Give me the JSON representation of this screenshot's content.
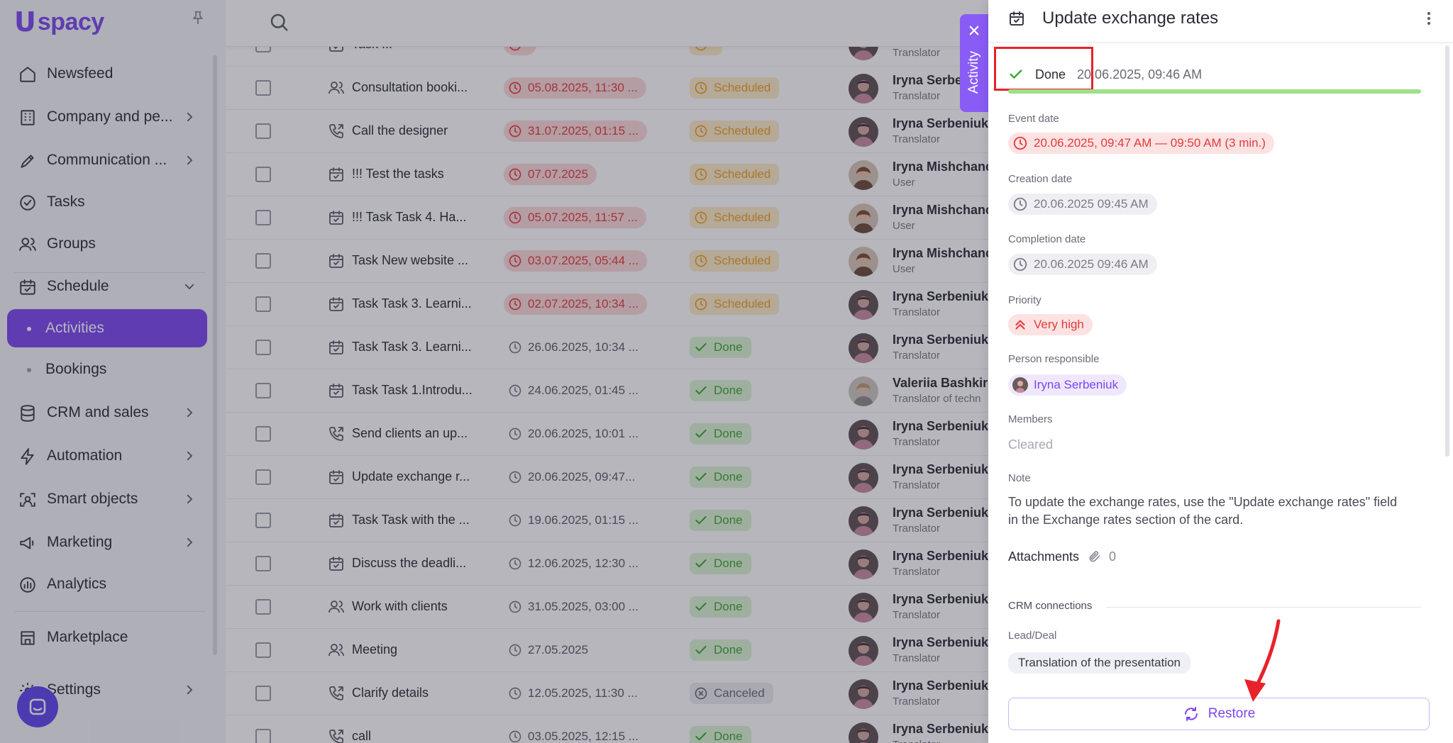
{
  "sidebar": {
    "logo_u": "U",
    "logo_text": "spacy",
    "items": [
      {
        "label": "Newsfeed",
        "icon": "home-icon"
      },
      {
        "label": "Company and pe...",
        "icon": "company-icon"
      },
      {
        "label": "Communication ...",
        "icon": "communication-icon"
      },
      {
        "label": "Tasks",
        "icon": "check-circle-icon"
      },
      {
        "label": "Groups",
        "icon": "groups-icon"
      },
      {
        "label": "Schedule",
        "icon": "calendar-icon"
      },
      {
        "label": "Activities"
      },
      {
        "label": "Bookings"
      },
      {
        "label": "CRM and sales",
        "icon": "database-icon"
      },
      {
        "label": "Automation",
        "icon": "lightning-icon"
      },
      {
        "label": "Smart objects",
        "icon": "smart-objects-icon"
      },
      {
        "label": "Marketing",
        "icon": "marketing-icon"
      },
      {
        "label": "Analytics",
        "icon": "analytics-icon"
      },
      {
        "label": "Marketplace",
        "icon": "store-icon"
      },
      {
        "label": "Settings",
        "icon": "gear-icon"
      }
    ]
  },
  "table": {
    "rows": [
      {
        "name": "Task ...",
        "type": "task",
        "date": "",
        "date_style": "over",
        "status": "",
        "status_style": "scheduled",
        "user": "",
        "role": "Translator",
        "avatar": "iryna-s"
      },
      {
        "name": "Consultation booki...",
        "type": "people",
        "date": "05.08.2025, 11:30 ...",
        "date_style": "over",
        "status": "Scheduled",
        "status_style": "scheduled",
        "user": "Iryna Serbeniuk",
        "role": "Translator",
        "avatar": "iryna-s"
      },
      {
        "name": "Call the designer",
        "type": "call",
        "date": "31.07.2025, 01:15 ...",
        "date_style": "over",
        "status": "Scheduled",
        "status_style": "scheduled",
        "user": "Iryna Serbeniuk",
        "role": "Translator",
        "avatar": "iryna-s"
      },
      {
        "name": "!!! Test the tasks",
        "type": "task",
        "date": "07.07.2025",
        "date_style": "over",
        "status": "Scheduled",
        "status_style": "scheduled",
        "user": "Iryna Mishchanc",
        "role": "User",
        "avatar": "iryna-m"
      },
      {
        "name": "!!! Task Task 4. Ha...",
        "type": "task",
        "date": "05.07.2025, 11:57 ...",
        "date_style": "over",
        "status": "Scheduled",
        "status_style": "scheduled",
        "user": "Iryna Mishchanc",
        "role": "User",
        "avatar": "iryna-m"
      },
      {
        "name": "Task New website ...",
        "type": "task",
        "date": "03.07.2025, 05:44 ...",
        "date_style": "over",
        "status": "Scheduled",
        "status_style": "scheduled",
        "user": "Iryna Mishchanc",
        "role": "User",
        "avatar": "iryna-m"
      },
      {
        "name": "Task Task 3. Learni...",
        "type": "task",
        "date": "02.07.2025, 10:34 ...",
        "date_style": "over",
        "status": "Scheduled",
        "status_style": "scheduled",
        "user": "Iryna Serbeniuk",
        "role": "Translator",
        "avatar": "iryna-s"
      },
      {
        "name": "Task Task 3. Learni...",
        "type": "task",
        "date": "26.06.2025, 10:34 ...",
        "date_style": "norm",
        "status": "Done",
        "status_style": "done",
        "user": "Iryna Serbeniuk",
        "role": "Translator",
        "avatar": "iryna-s"
      },
      {
        "name": "Task Task 1.Introdu...",
        "type": "task",
        "date": "24.06.2025, 01:45 ...",
        "date_style": "norm",
        "status": "Done",
        "status_style": "done",
        "user": "Valeriia Bashkiro",
        "role": "Translator of techn",
        "avatar": "valeriia"
      },
      {
        "name": "Send clients an up...",
        "type": "call",
        "date": "20.06.2025, 10:01 ...",
        "date_style": "norm",
        "status": "Done",
        "status_style": "done",
        "user": "Iryna Serbeniuk",
        "role": "Translator",
        "avatar": "iryna-s"
      },
      {
        "name": "Update exchange r...",
        "type": "task",
        "date": "20.06.2025, 09:47...",
        "date_style": "norm",
        "status": "Done",
        "status_style": "done",
        "user": "Iryna Serbeniuk",
        "role": "Translator",
        "avatar": "iryna-s"
      },
      {
        "name": "Task Task with the ...",
        "type": "task",
        "date": "19.06.2025, 01:15 ...",
        "date_style": "norm",
        "status": "Done",
        "status_style": "done",
        "user": "Iryna Serbeniuk",
        "role": "Translator",
        "avatar": "iryna-s"
      },
      {
        "name": "Discuss the deadli...",
        "type": "task",
        "date": "12.06.2025, 12:30 ...",
        "date_style": "norm",
        "status": "Done",
        "status_style": "done",
        "user": "Iryna Serbeniuk",
        "role": "Translator",
        "avatar": "iryna-s"
      },
      {
        "name": "Work with clients",
        "type": "people",
        "date": "31.05.2025, 03:00 ...",
        "date_style": "norm",
        "status": "Done",
        "status_style": "done",
        "user": "Iryna Serbeniuk",
        "role": "Translator",
        "avatar": "iryna-s"
      },
      {
        "name": "Meeting",
        "type": "people",
        "date": "27.05.2025",
        "date_style": "norm",
        "status": "Done",
        "status_style": "done",
        "user": "Iryna Serbeniuk",
        "role": "Translator",
        "avatar": "iryna-s"
      },
      {
        "name": "Clarify details",
        "type": "call",
        "date": "12.05.2025, 11:30 ...",
        "date_style": "norm",
        "status": "Canceled",
        "status_style": "canceled",
        "user": "Iryna Serbeniuk",
        "role": "Translator",
        "avatar": "iryna-s"
      },
      {
        "name": "call",
        "type": "call",
        "date": "03.05.2025, 12:15 ...",
        "date_style": "norm",
        "status": "Done",
        "status_style": "done",
        "user": "Iryna Serbeniuk",
        "role": "Translator",
        "avatar": "iryna-s"
      }
    ]
  },
  "activity_tab": {
    "label": "Activity"
  },
  "drawer": {
    "title": "Update exchange rates",
    "status": "Done",
    "status_date": "20.06.2025, 09:46 AM",
    "progress": 1.0,
    "event_date_label": "Event date",
    "event_date": "20.06.2025, 09:47 AM — 09:50 AM (3 min.)",
    "creation_date_label": "Creation date",
    "creation_date": "20.06.2025 09:45 AM",
    "completion_date_label": "Completion date",
    "completion_date": "20.06.2025 09:46 AM",
    "priority_label": "Priority",
    "priority": "Very high",
    "person_label": "Person responsible",
    "person": "Iryna Serbeniuk",
    "members_label": "Members",
    "members": "Cleared",
    "note_label": "Note",
    "note": "To update the exchange rates, use the \"Update exchange rates\" field in the Exchange rates section of the card.",
    "attachments_label": "Attachments",
    "attachments_count": "0",
    "crm_label": "CRM connections",
    "lead_label": "Lead/Deal",
    "lead": "Translation of the presentation",
    "restore_label": "Restore"
  },
  "colors": {
    "accent": "#7b46f0",
    "overdue": "#e23b3b",
    "done": "#3aa82e",
    "scheduled": "#f0a020",
    "highlight": "#e8222a"
  }
}
